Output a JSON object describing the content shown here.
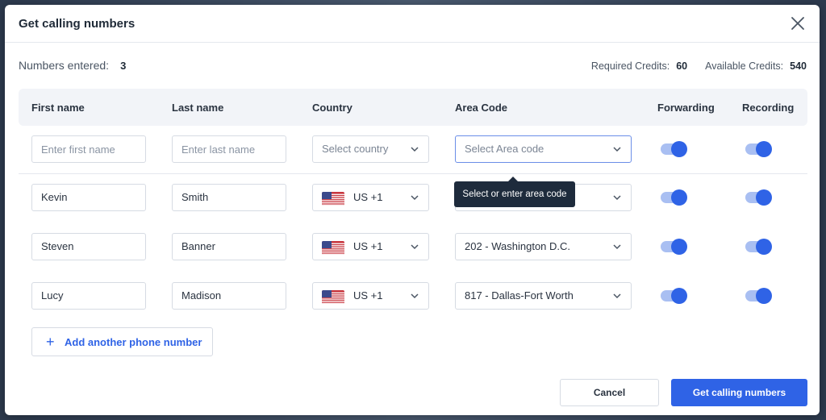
{
  "modal": {
    "title": "Get calling numbers",
    "close_icon": "close-icon"
  },
  "summary": {
    "numbers_entered_label": "Numbers entered:",
    "numbers_entered_value": "3",
    "required_credits_label": "Required Credits:",
    "required_credits_value": "60",
    "available_credits_label": "Available Credits:",
    "available_credits_value": "540"
  },
  "table": {
    "headers": {
      "first_name": "First name",
      "last_name": "Last name",
      "country": "Country",
      "area_code": "Area Code",
      "forwarding": "Forwarding",
      "recording": "Recording"
    },
    "new_row": {
      "first_name_placeholder": "Enter first name",
      "last_name_placeholder": "Enter last name",
      "country_placeholder": "Select country",
      "area_code_placeholder": "Select Area code",
      "forwarding": true,
      "recording": true
    },
    "rows": [
      {
        "first_name": "Kevin",
        "last_name": "Smith",
        "country": "US +1",
        "country_flag": "us-flag-icon",
        "area_code": "",
        "forwarding": true,
        "recording": true
      },
      {
        "first_name": "Steven",
        "last_name": "Banner",
        "country": "US +1",
        "country_flag": "us-flag-icon",
        "area_code": "202 - Washington D.C.",
        "forwarding": true,
        "recording": true
      },
      {
        "first_name": "Lucy",
        "last_name": "Madison",
        "country": "US +1",
        "country_flag": "us-flag-icon",
        "area_code": "817 - Dallas-Fort Worth",
        "forwarding": true,
        "recording": true
      }
    ]
  },
  "tooltip": {
    "text": "Select or enter area code"
  },
  "actions": {
    "add_label": "Add another phone number",
    "cancel_label": "Cancel",
    "submit_label": "Get calling numbers"
  },
  "colors": {
    "primary": "#2f63e6",
    "toggle_track": "#a9bff2",
    "tooltip_bg": "#1e2b3c",
    "header_bg": "#f2f4f8"
  }
}
